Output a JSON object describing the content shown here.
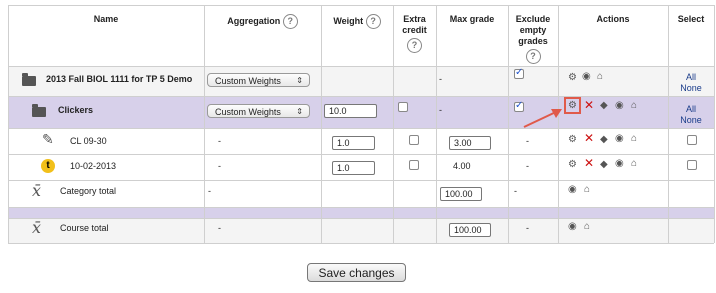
{
  "headers": {
    "name": "Name",
    "aggregation": "Aggregation",
    "weight": "Weight",
    "extra_credit_1": "Extra",
    "extra_credit_2": "credit",
    "max_grade": "Max grade",
    "exclude_1": "Exclude",
    "exclude_2": "empty",
    "exclude_3": "grades",
    "actions": "Actions",
    "select": "Select",
    "help_glyph": "?"
  },
  "course_row": {
    "name": "2013 Fall BIOL 1111 for TP 5 Demo",
    "aggregation": "Custom Weights",
    "max_grade": "-",
    "exclude_checked": true,
    "select_all": "All",
    "select_none": "None"
  },
  "category_row": {
    "name": "Clickers",
    "aggregation": "Custom Weights",
    "weight": "10.0",
    "max_grade": "-",
    "exclude_checked": true,
    "select_all": "All",
    "select_none": "None"
  },
  "items": [
    {
      "name": "CL 09-30",
      "aggregation": "-",
      "weight": "1.0",
      "max_grade": "3.00",
      "exclude": "-"
    },
    {
      "name": "10-02-2013",
      "aggregation": "-",
      "weight": "1.0",
      "max_grade": "4.00",
      "exclude": "-"
    }
  ],
  "category_total": {
    "name": "Category total",
    "aggregation": "-",
    "max_grade": "100.00",
    "exclude": "-"
  },
  "course_total": {
    "name": "Course total",
    "aggregation": "-",
    "max_grade": "100.00",
    "exclude": "-"
  },
  "save_button": "Save changes",
  "colors": {
    "category_bg": "#d7d0ea",
    "grid": "#cfcfcf",
    "highlight": "#e05a4a",
    "delete": "#cc1111"
  },
  "icons": {
    "gear": "⚙",
    "eye": "👁",
    "lock": "🔒",
    "move": "⬍"
  }
}
